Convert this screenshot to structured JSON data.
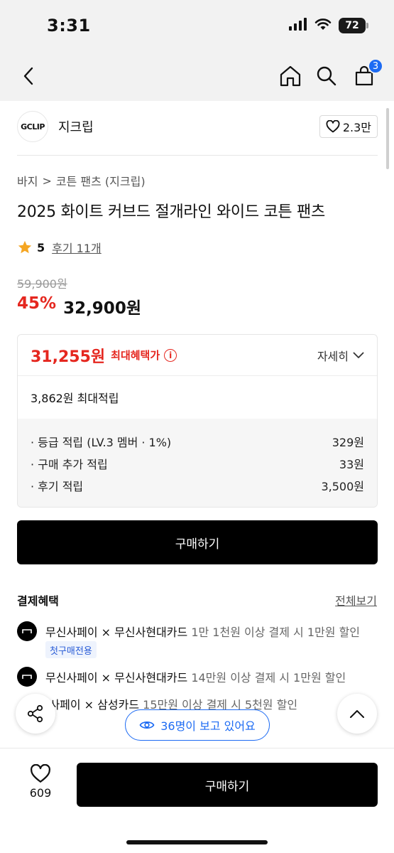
{
  "status_bar": {
    "time": "3:31",
    "battery": "72"
  },
  "nav": {
    "cart_count": "3",
    "icons": [
      "back-icon",
      "home-icon",
      "search-icon",
      "cart-icon"
    ]
  },
  "brand": {
    "logo_text": "GCLIP",
    "name": "지크립",
    "likes": "2.3만"
  },
  "breadcrumb": {
    "category": "바지",
    "separator": ">",
    "subcategory": "코튼 팬츠 (지크립)"
  },
  "product": {
    "title": "2025 화이트 커브드 절개라인 와이드 코튼 팬츠",
    "rating": "5",
    "review_link": "후기 11개",
    "original_price": "59,900원",
    "discount": "45%",
    "sale_price": "32,900원"
  },
  "benefit": {
    "max_price": "31,255원",
    "max_label": "최대혜택가",
    "info_glyph": "i",
    "detail_label": "자세히",
    "points_total": "3,862원 최대적립",
    "points": [
      {
        "label": "· 등급 적립 (LV.3 멤버 · 1%)",
        "value": "329원"
      },
      {
        "label": "· 구매 추가 적립",
        "value": "33원"
      },
      {
        "label": "· 후기 적립",
        "value": "3,500원"
      }
    ]
  },
  "buy_label": "구매하기",
  "payment": {
    "title": "결제혜택",
    "view_all": "전체보기",
    "first_purchase_tag": "첫구매전용",
    "items": [
      {
        "name": "무신사페이 × 무신사현대카드",
        "condition": "1만 1천원 이상 결제 시 1만원 할인"
      },
      {
        "name": "무신사페이 × 무신사현대카드",
        "condition": "14만원 이상 결제 시 1만원 할인"
      },
      {
        "name": "무신사페이 × 삼성카드",
        "condition": "15만원 이상 결제 시 5천원 할인"
      }
    ]
  },
  "viewers": "36명이 보고 있어요",
  "bottom": {
    "like_count": "609",
    "buy_label": "구매하기"
  },
  "colors": {
    "accent_red": "#e5271f",
    "accent_blue": "#1d6bf3",
    "button_black": "#000000"
  }
}
